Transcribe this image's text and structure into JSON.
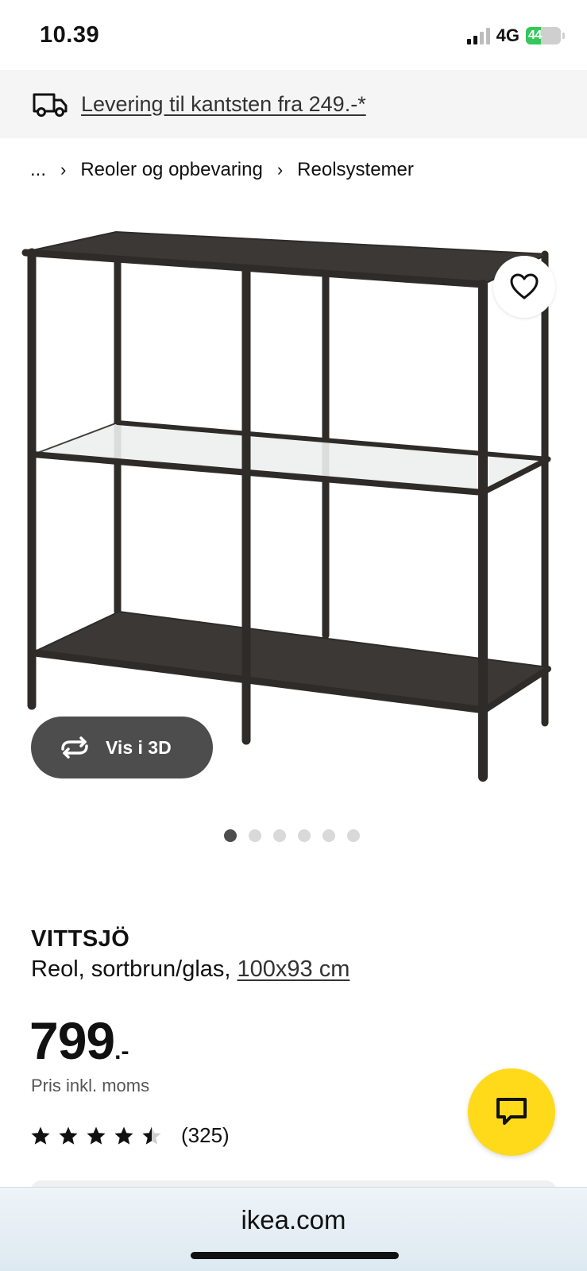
{
  "status_bar": {
    "time": "10.39",
    "network": "4G",
    "battery_level": "44",
    "battery_color": "#34c759"
  },
  "delivery_banner": {
    "icon": "truck-icon",
    "text": "Levering til kantsten fra 249.-*"
  },
  "breadcrumb": {
    "items": [
      "...",
      "Reoler og opbevaring",
      "Reolsystemer"
    ],
    "separator": "›"
  },
  "gallery": {
    "image_count": 6,
    "active_index": 0,
    "view3d_label": "Vis i 3D",
    "view3d_icon": "rotate-icon",
    "favorite_icon": "heart-icon"
  },
  "product": {
    "name": "VITTSJÖ",
    "description_prefix": "Reol, sortbrun/glas, ",
    "size_link": "100x93 cm",
    "price_value": "799",
    "price_suffix": ".-",
    "price_note": "Pris inkl. moms",
    "rating": 4.5,
    "rating_max": 5,
    "review_count": "(325)"
  },
  "chat": {
    "icon": "chat-bubble-icon",
    "color": "#ffda1a"
  },
  "browser": {
    "url": "ikea.com"
  }
}
